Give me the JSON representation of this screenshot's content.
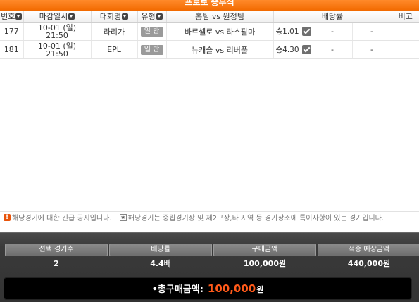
{
  "title": "프로토 승부식",
  "columns": {
    "no": "번호",
    "deadline": "마감일시",
    "league": "대회명",
    "type": "유형",
    "match": "홈팀  vs 원정팀",
    "odds": "배당률",
    "note": "비고"
  },
  "rows": [
    {
      "no": "177",
      "date": "10-01 (일)",
      "time": "21:50",
      "league": "라리가",
      "type": "일 반",
      "match": "바르셀로 vs 라스팔마",
      "pick": "승1.01",
      "odds_b": "-",
      "odds_c": "-",
      "note": ""
    },
    {
      "no": "181",
      "date": "10-01 (일)",
      "time": "21:50",
      "league": "EPL",
      "type": "일 반",
      "match": "뉴캐슬 vs 리버풀",
      "pick": "승4.30",
      "odds_b": "-",
      "odds_c": "-",
      "note": ""
    }
  ],
  "notice": {
    "alert_text": "해당경기에 대한 긴급 공지입니다.",
    "star_text": "해당경기는 중립경기장 및 제2구장,타 지역 등 경기장소에 특이사항이 있는 경기입니다."
  },
  "summary": {
    "selected_label": "선택 경기수",
    "selected_value": "2",
    "odds_label": "배당률",
    "odds_value": "4.4배",
    "amount_label": "구매금액",
    "amount_value": "100,000원",
    "expected_label": "적중 예상금액",
    "expected_value": "440,000원"
  },
  "total": {
    "label": "•총구매금액:",
    "amount": "100,000",
    "unit": "원"
  },
  "colors": {
    "title_bar": "#f26a00",
    "total_amount": "#ff5a1a",
    "alert_icon": "#e8540b"
  },
  "icons": {
    "sort": "sort-down-icon",
    "check": "checkbox-checked-icon",
    "alert": "alert-icon",
    "star": "star-icon"
  }
}
